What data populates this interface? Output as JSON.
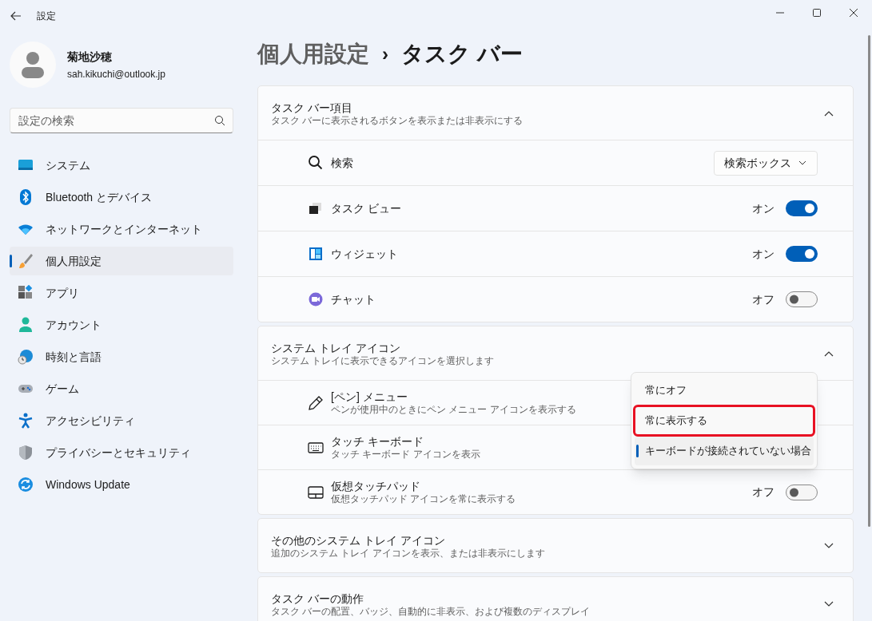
{
  "window": {
    "title": "設定"
  },
  "account": {
    "name": "菊地沙穂",
    "email": "sah.kikuchi@outlook.jp"
  },
  "search": {
    "placeholder": "設定の検索"
  },
  "sidebar": {
    "items": [
      {
        "label": "システム",
        "selected": false
      },
      {
        "label": "Bluetooth とデバイス",
        "selected": false
      },
      {
        "label": "ネットワークとインターネット",
        "selected": false
      },
      {
        "label": "個人用設定",
        "selected": true
      },
      {
        "label": "アプリ",
        "selected": false
      },
      {
        "label": "アカウント",
        "selected": false
      },
      {
        "label": "時刻と言語",
        "selected": false
      },
      {
        "label": "ゲーム",
        "selected": false
      },
      {
        "label": "アクセシビリティ",
        "selected": false
      },
      {
        "label": "プライバシーとセキュリティ",
        "selected": false
      },
      {
        "label": "Windows Update",
        "selected": false
      }
    ]
  },
  "breadcrumb": {
    "parent": "個人用設定",
    "separator": "›",
    "current": "タスク バー"
  },
  "sections": [
    {
      "title": "タスク バー項目",
      "description": "タスク バーに表示されるボタンを表示または非表示にする",
      "expanded": true,
      "rows": [
        {
          "kind": "dropdown",
          "label": "検索",
          "value": "検索ボックス"
        },
        {
          "kind": "toggle",
          "label": "タスク ビュー",
          "state_text": "オン",
          "on": true
        },
        {
          "kind": "toggle",
          "label": "ウィジェット",
          "state_text": "オン",
          "on": true
        },
        {
          "kind": "toggle",
          "label": "チャット",
          "state_text": "オフ",
          "on": false
        }
      ]
    },
    {
      "title": "システム トレイ アイコン",
      "description": "システム トレイに表示できるアイコンを選択します",
      "expanded": true,
      "rows": [
        {
          "kind": "covered",
          "label": "[ペン] メニュー",
          "description": "ペンが使用中のときにペン メニュー アイコンを表示する"
        },
        {
          "kind": "covered",
          "label": "タッチ キーボード",
          "description": "タッチ キーボード アイコンを表示"
        },
        {
          "kind": "toggle",
          "label": "仮想タッチパッド",
          "description": "仮想タッチパッド アイコンを常に表示する",
          "state_text": "オフ",
          "on": false
        }
      ]
    },
    {
      "title": "その他のシステム トレイ アイコン",
      "description": "追加のシステム トレイ アイコンを表示、または非表示にします",
      "expanded": false
    },
    {
      "title": "タスク バーの動作",
      "description": "タスク バーの配置、バッジ、自動的に非表示、および複数のディスプレイ",
      "expanded": false
    }
  ],
  "popup_menu": {
    "options": [
      {
        "label": "常にオフ",
        "selected": false,
        "annotated": false
      },
      {
        "label": "常に表示する",
        "selected": false,
        "annotated": true
      },
      {
        "label": "キーボードが接続されていない場合",
        "selected": true,
        "annotated": false
      }
    ]
  }
}
